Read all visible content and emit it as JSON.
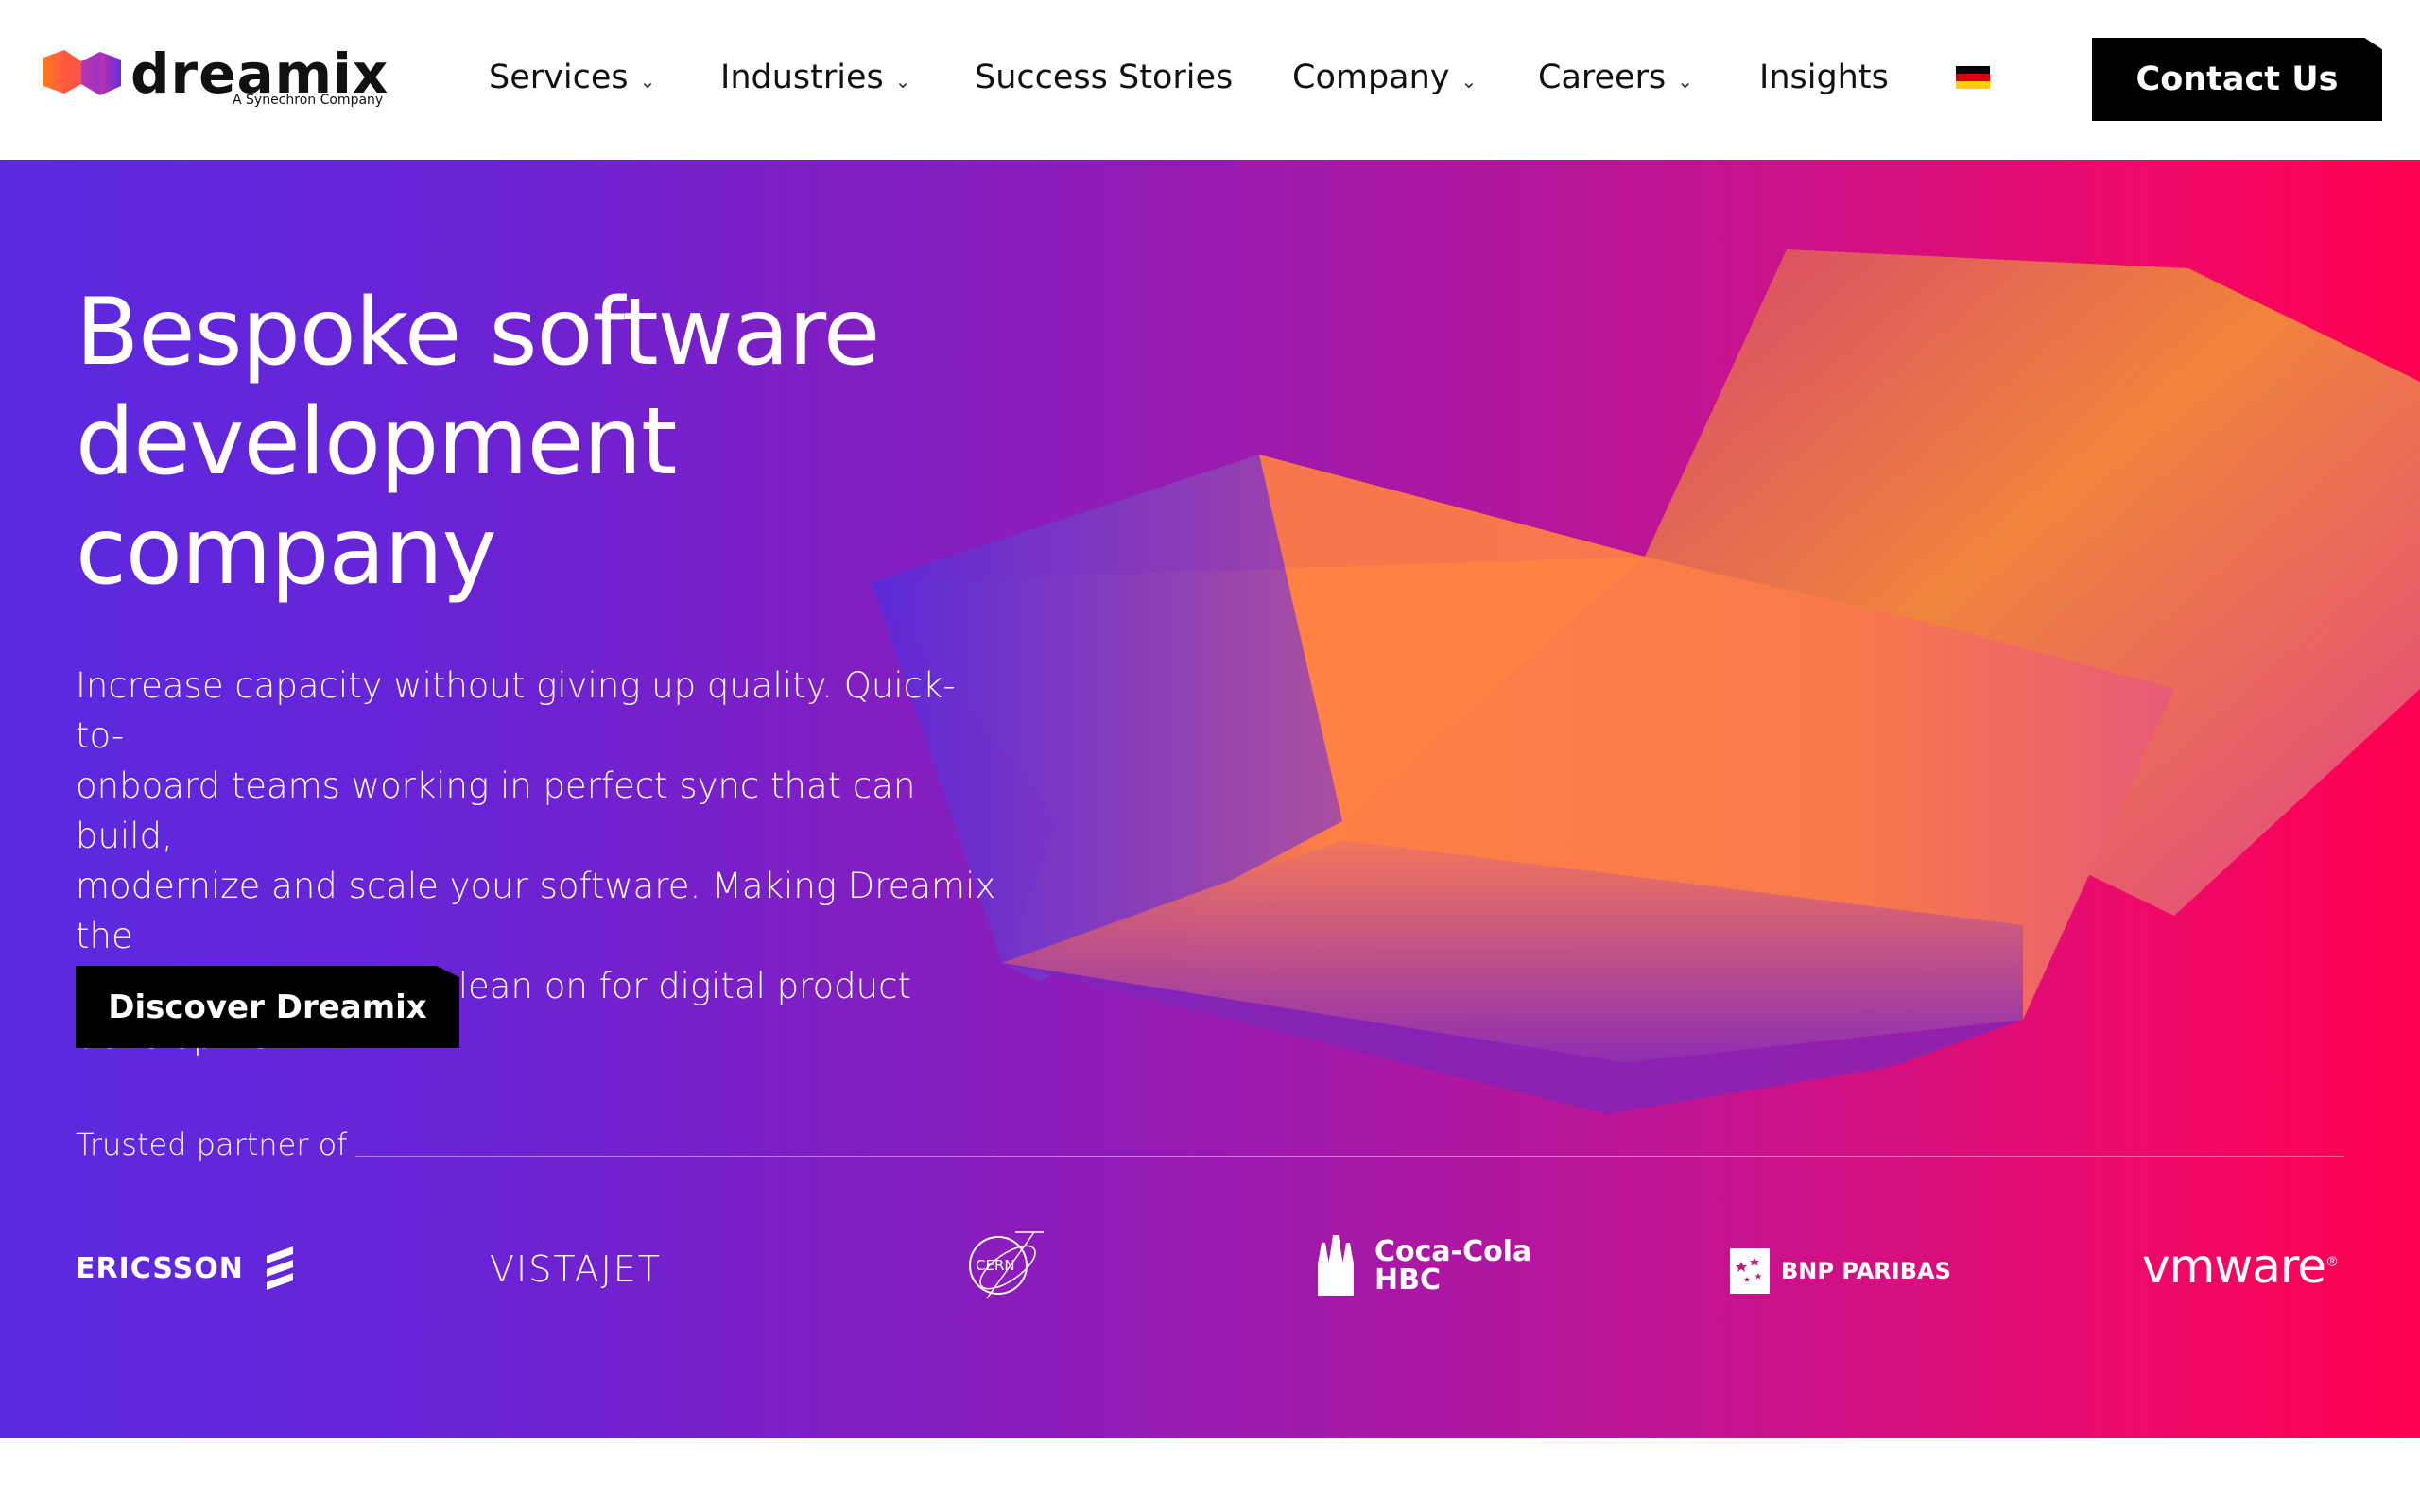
{
  "header": {
    "logo": {
      "word": "dreamix",
      "tagline": "A Synechron Company"
    },
    "nav": [
      {
        "label": "Services",
        "has_dropdown": true
      },
      {
        "label": "Industries",
        "has_dropdown": true
      },
      {
        "label": "Success Stories",
        "has_dropdown": false
      },
      {
        "label": "Company",
        "has_dropdown": true
      },
      {
        "label": "Careers",
        "has_dropdown": true
      },
      {
        "label": "Insights",
        "has_dropdown": false
      }
    ],
    "language_flag": "germany-flag-icon",
    "contact_label": "Contact Us"
  },
  "hero": {
    "title_lines": [
      "Bespoke software",
      "development",
      "company"
    ],
    "description_lines": [
      "Increase capacity without giving up quality. Quick-to-",
      "onboard teams working in perfect sync that can build,",
      "modernize and scale your software. Making Dreamix the",
      "solid partner you can lean on for digital product",
      "development."
    ],
    "cta_label": "Discover Dreamix",
    "trusted_label": "Trusted partner of",
    "partners": {
      "ericsson": "ERICSSON",
      "vistajet": "VISTAJET",
      "cern": "CERN",
      "coca_cola_line1": "Coca-Cola",
      "coca_cola_line2": "HBC",
      "bnp": "BNP PARIBAS",
      "vmware": "vmware",
      "vmware_mark": "®"
    }
  },
  "colors": {
    "gradient_start": "#5b2ae0",
    "gradient_end": "#ff0050",
    "shape_orange": "#ff8a3c",
    "button_bg": "#000000"
  }
}
